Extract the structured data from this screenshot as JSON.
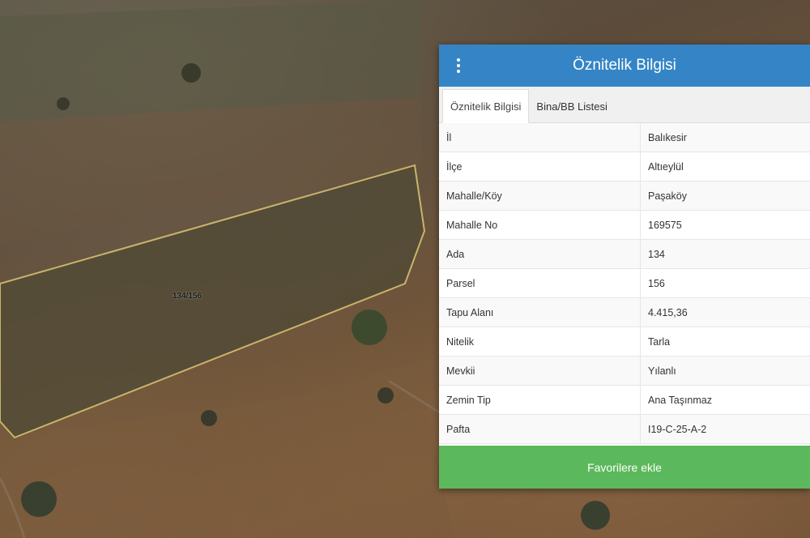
{
  "map": {
    "parcel_label": "134/156"
  },
  "panel": {
    "title": "Öznitelik Bilgisi",
    "menu_icon": "vertical-dots-icon",
    "tabs": [
      {
        "label": "Öznitelik Bilgisi",
        "active": true
      },
      {
        "label": "Bina/BB Listesi",
        "active": false
      }
    ],
    "rows": [
      {
        "key": "İl",
        "value": "Balıkesir"
      },
      {
        "key": "İlçe",
        "value": "Altıeylül"
      },
      {
        "key": "Mahalle/Köy",
        "value": "Paşaköy"
      },
      {
        "key": "Mahalle No",
        "value": "169575"
      },
      {
        "key": "Ada",
        "value": "134"
      },
      {
        "key": "Parsel",
        "value": "156"
      },
      {
        "key": "Tapu Alanı",
        "value": "4.415,36"
      },
      {
        "key": "Nitelik",
        "value": "Tarla"
      },
      {
        "key": "Mevkii",
        "value": "Yılanlı"
      },
      {
        "key": "Zemin Tip",
        "value": "Ana Taşınmaz"
      },
      {
        "key": "Pafta",
        "value": "I19-C-25-A-2"
      }
    ],
    "favorite_button_label": "Favorilere ekle"
  },
  "colors": {
    "header": "#3585c6",
    "favorite_button": "#5cb85c",
    "parcel_outline": "#c9b56a"
  }
}
